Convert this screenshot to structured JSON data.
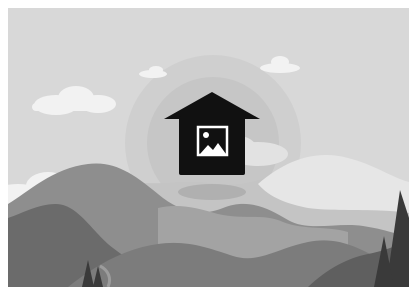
{
  "placeholder": {
    "icon": "home-image-icon",
    "palette": {
      "sky": "#d8d8d8",
      "sun_outer": "#cccccc",
      "sun_inner": "#c3c3c3",
      "cloud": "#f2f2f2",
      "far_hills": "#bdbdbd",
      "mid_hills": "#9a9a9a",
      "front_hills": "#6b6b6b",
      "trees": "#3b3b3b",
      "icon_dark": "#111111",
      "icon_light": "#ffffff"
    }
  }
}
